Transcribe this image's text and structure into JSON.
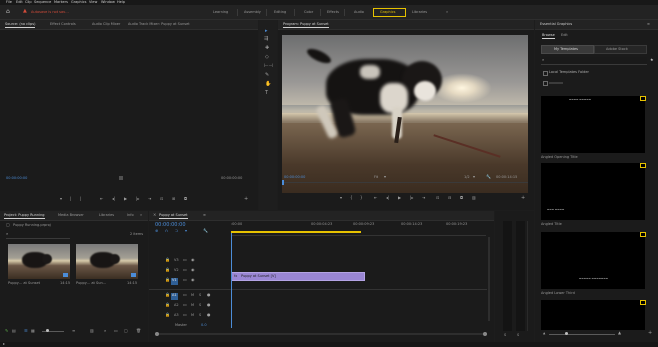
{
  "menubar": {
    "items": [
      "File",
      "Edit",
      "Clip",
      "Sequence",
      "Markers",
      "Graphics",
      "View",
      "Window",
      "Help"
    ],
    "warning": "Autosave is not sav…"
  },
  "workspaces": [
    "Learning",
    "Assembly",
    "Editing",
    "Color",
    "Effects",
    "Audio",
    "Graphics",
    "Libraries"
  ],
  "workspace_active": "Graphics",
  "workspace_more": "»",
  "source_panel": {
    "tabs": [
      "Source: (no clips)",
      "Effect Controls",
      "Audio Clip Mixer",
      "Audio Track Mixer: Puppy at Sunset"
    ],
    "tc_left": "00:00:00:00",
    "tc_right": "00:00:00:00"
  },
  "program": {
    "title": "Program: Puppy at Sunset",
    "timecode": "00:00:00:00",
    "fit": "Fit",
    "ratio": "1/2",
    "duration": "00:00:14:15"
  },
  "project": {
    "tabs": [
      "Project: Puppy Running",
      "Media Browser",
      "Libraries",
      "Info"
    ],
    "more": "»",
    "file": "Puppy Running.prproj",
    "count": "2 items",
    "clips": [
      {
        "name": "Puppy… at Sunset",
        "dur": "14:15"
      },
      {
        "name": "Puppy… at Sun…",
        "dur": "14:15"
      }
    ]
  },
  "timeline": {
    "tab": "Puppy at Sunset",
    "timecode": "00:00:00:00",
    "ruler": [
      ":00:00",
      "00:00:04:23",
      "00:00:09:23",
      "00:00:14:23",
      "00:00:19:23"
    ],
    "video_tracks": [
      "V3",
      "V2",
      "V1"
    ],
    "audio_tracks": [
      "A1",
      "A2",
      "A3"
    ],
    "master": "Master",
    "master_val": "0.0",
    "clip": "Puppy at Sunset [V]"
  },
  "essential_graphics": {
    "title": "Essential Graphics",
    "more": "≡",
    "tabs": [
      "Browse",
      "Edit"
    ],
    "templates": "My Templates",
    "stock": "Adobe Stock",
    "filter": "Local Templates Folder",
    "items": [
      {
        "title_text": "▬▬▬▬ ▬▬▬▬▬",
        "label": "Angled Opening Title"
      },
      {
        "title_text": "▬▬▬ ▬▬▬▬",
        "label": "Angled Title"
      },
      {
        "title_text": "▬▬▬▬▬ ▬▬▬▬▬▬▬",
        "label": "Angled Lower Third"
      }
    ]
  },
  "colors": {
    "accent": "#4c8dd8",
    "active_ws": "#e6c200",
    "clip": "#9a86d4",
    "warning": "#d34c3a"
  }
}
